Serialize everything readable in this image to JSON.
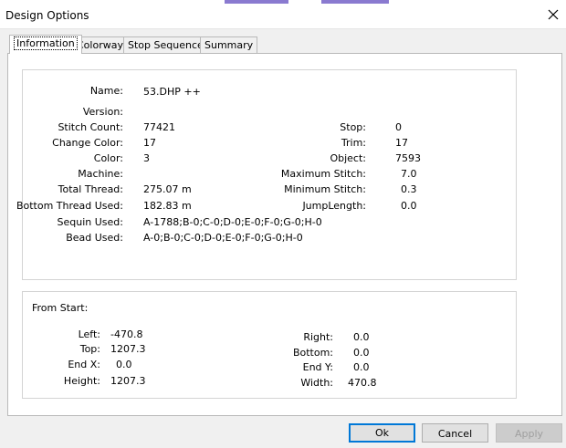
{
  "window": {
    "title": "Design Options"
  },
  "tabs": [
    "Information",
    "Colorway",
    "Stop Sequence",
    "Summary"
  ],
  "info": {
    "left": [
      {
        "label": "Name:",
        "value": "53.DHP ++"
      },
      {
        "label": "Version:",
        "value": ""
      },
      {
        "label": "Stitch Count:",
        "value": "77421"
      },
      {
        "label": "Change Color:",
        "value": "17"
      },
      {
        "label": "Color:",
        "value": "3"
      },
      {
        "label": "Machine:",
        "value": ""
      },
      {
        "label": "Total Thread:",
        "value": "275.07 m"
      },
      {
        "label": "Bottom Thread Used:",
        "value": "182.83 m"
      },
      {
        "label": "Sequin Used:",
        "value": "A-1788;B-0;C-0;D-0;E-0;F-0;G-0;H-0"
      },
      {
        "label": "Bead Used:",
        "value": "A-0;B-0;C-0;D-0;E-0;F-0;G-0;H-0"
      }
    ],
    "right": [
      {
        "label": "Stop:",
        "value": "0"
      },
      {
        "label": "Trim:",
        "value": "17"
      },
      {
        "label": "Object:",
        "value": "7593"
      },
      {
        "label": "Maximum Stitch:",
        "value": "7.0"
      },
      {
        "label": "Minimum Stitch:",
        "value": "0.3"
      },
      {
        "label": "JumpLength:",
        "value": "0.0"
      }
    ]
  },
  "from_start": {
    "heading": "From Start:",
    "left": [
      {
        "label": "Left:",
        "value": "-470.8"
      },
      {
        "label": "Top:",
        "value": "1207.3"
      },
      {
        "label": "End X:",
        "value": "0.0"
      },
      {
        "label": "Height:",
        "value": "1207.3"
      }
    ],
    "right": [
      {
        "label": "Right:",
        "value": "0.0"
      },
      {
        "label": "Bottom:",
        "value": "0.0"
      },
      {
        "label": "End Y:",
        "value": "0.0"
      },
      {
        "label": "Width:",
        "value": "470.8"
      }
    ]
  },
  "buttons": {
    "ok": "Ok",
    "cancel": "Cancel",
    "apply": "Apply"
  }
}
